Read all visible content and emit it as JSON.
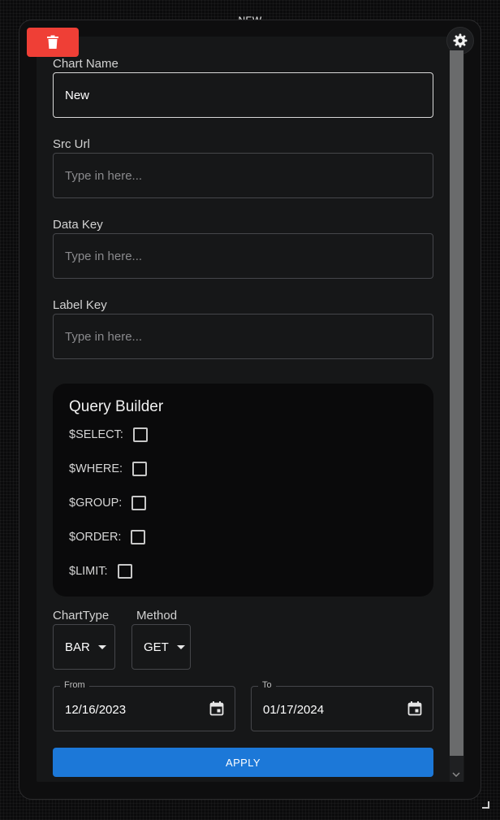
{
  "window": {
    "title": "NEW"
  },
  "form": {
    "chart_name": {
      "label": "Chart Name",
      "value": "New"
    },
    "src_url": {
      "label": "Src Url",
      "placeholder": "Type in here..."
    },
    "data_key": {
      "label": "Data Key",
      "placeholder": "Type in here..."
    },
    "label_key": {
      "label": "Label Key",
      "placeholder": "Type in here..."
    }
  },
  "query_builder": {
    "title": "Query Builder",
    "items": [
      {
        "label": "$SELECT:",
        "checked": false
      },
      {
        "label": "$WHERE:",
        "checked": false
      },
      {
        "label": "$GROUP:",
        "checked": false
      },
      {
        "label": "$ORDER:",
        "checked": false
      },
      {
        "label": "$LIMIT:",
        "checked": false
      }
    ]
  },
  "chart_type": {
    "label": "ChartType",
    "value": "BAR"
  },
  "method": {
    "label": "Method",
    "value": "GET"
  },
  "dates": {
    "from": {
      "label": "From",
      "value": "12/16/2023"
    },
    "to": {
      "label": "To",
      "value": "01/17/2024"
    }
  },
  "apply": {
    "label": "APPLY"
  },
  "icons": {
    "delete": "trash-icon",
    "settings": "gear-icon",
    "calendar": "calendar-icon",
    "dropdown": "caret-down-icon"
  },
  "colors": {
    "delete_button": "#ef3f36",
    "apply_button": "#1c78d8",
    "panel": "#161718",
    "query_builder_bg": "#0a0a0b"
  }
}
